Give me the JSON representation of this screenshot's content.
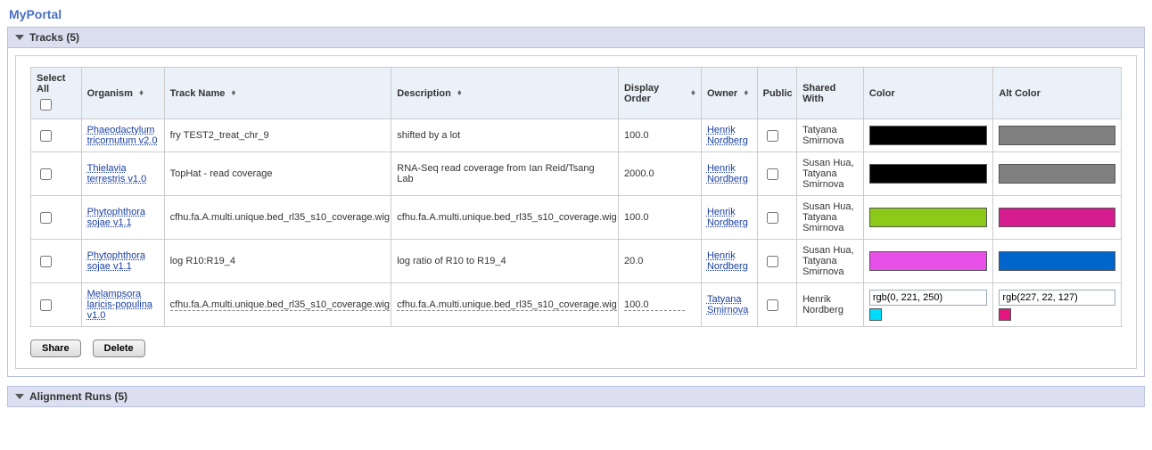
{
  "app_title": "MyPortal",
  "tracks_panel": {
    "title": "Tracks (5)"
  },
  "alignment_panel": {
    "title": "Alignment Runs (5)"
  },
  "headers": {
    "select_all": "Select All",
    "organism": "Organism",
    "track_name": "Track Name",
    "description": "Description",
    "display_order": "Display Order",
    "owner": "Owner",
    "public": "Public",
    "shared_with": "Shared With",
    "color": "Color",
    "alt_color": "Alt Color"
  },
  "rows": [
    {
      "organism": "Phaeodactylum tricornutum v2.0",
      "track": "fry TEST2_treat_chr_9",
      "desc": "shifted by a lot",
      "order": "100.0",
      "owner": "Henrik Nordberg",
      "shared": "Tatyana Smirnova",
      "color": "#000000",
      "alt": "#808080"
    },
    {
      "organism": "Thielavia terrestris v1.0",
      "track": "TopHat - read coverage",
      "desc": "RNA-Seq read coverage from Ian Reid/Tsang Lab",
      "order": "2000.0",
      "owner": "Henrik Nordberg",
      "shared": "Susan Hua, Tatyana Smirnova",
      "color": "#000000",
      "alt": "#808080"
    },
    {
      "organism": "Phytophthora sojae v1.1",
      "track": "cfhu.fa.A.multi.unique.bed_rl35_s10_coverage.wig",
      "desc": "cfhu.fa.A.multi.unique.bed_rl35_s10_coverage.wig",
      "order": "100.0",
      "owner": "Henrik Nordberg",
      "shared": "Susan Hua, Tatyana Smirnova",
      "color": "#8CC919",
      "alt": "#D61D8F"
    },
    {
      "organism": "Phytophthora sojae v1.1",
      "track": "log R10:R19_4",
      "desc": "log ratio of R10 to R19_4",
      "order": "20.0",
      "owner": "Henrik Nordberg",
      "shared": "Susan Hua, Tatyana Smirnova",
      "color": "#E750E7",
      "alt": "#0066CC"
    },
    {
      "organism": "Melampsora laricis-populina v1.0",
      "track": "cfhu.fa.A.multi.unique.bed_rl35_s10_coverage.wig",
      "desc": "cfhu.fa.A.multi.unique.bed_rl35_s10_coverage.wig",
      "order": "100.0",
      "owner": "Tatyana Smirnova",
      "shared": "Henrik Nordberg",
      "color_text": "rgb(0, 221, 250)",
      "color_swatch": "#00DDFA",
      "alt_text": "rgb(227, 22, 127)",
      "alt_swatch": "#E3167F",
      "editing": true
    }
  ],
  "buttons": {
    "share": "Share",
    "delete": "Delete"
  }
}
